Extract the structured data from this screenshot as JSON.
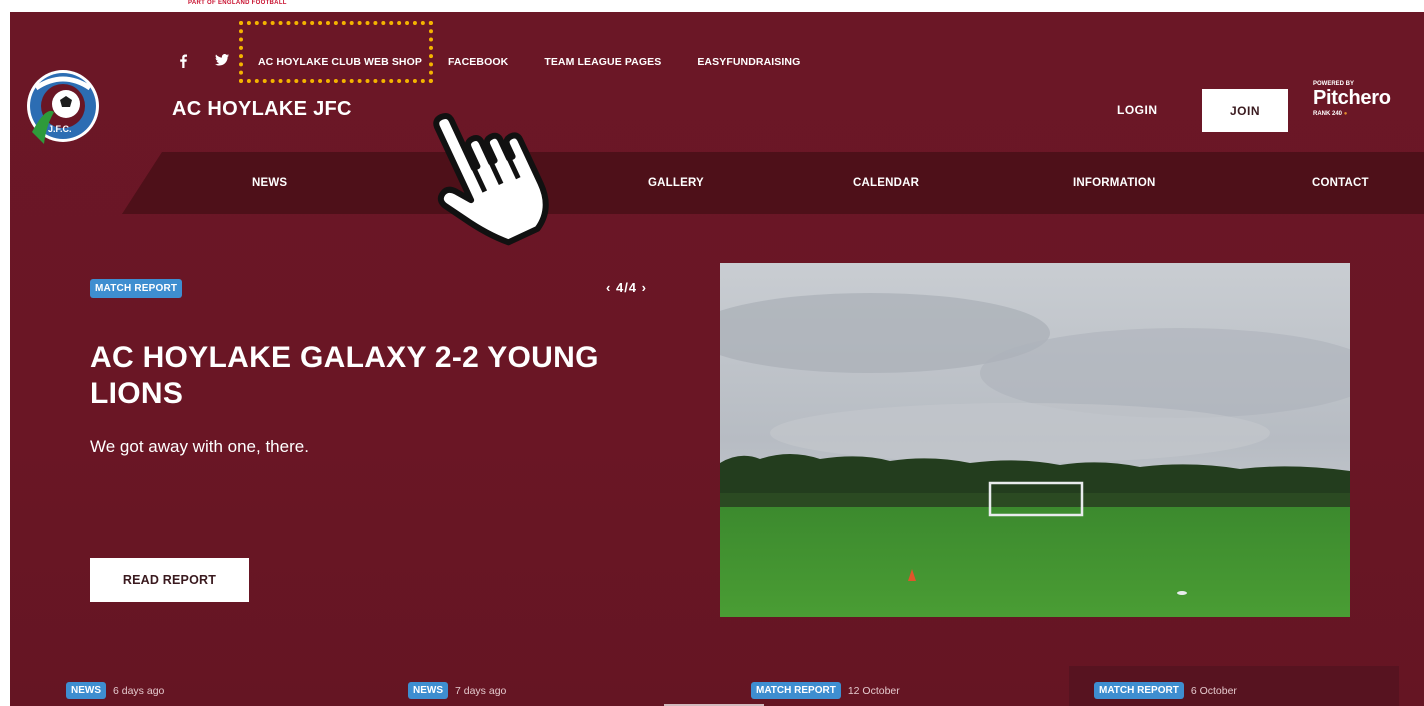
{
  "top_strip": {
    "tagline": "PART OF ENGLAND FOOTBALL"
  },
  "header": {
    "club_name": "AC HOYLAKE JFC",
    "social": {
      "facebook_icon": "facebook-icon",
      "twitter_icon": "twitter-icon"
    },
    "top_links": [
      {
        "label": "AC HOYLAKE CLUB WEB SHOP"
      },
      {
        "label": "FACEBOOK"
      },
      {
        "label": "TEAM LEAGUE PAGES"
      },
      {
        "label": "EASYFUNDRAISING"
      }
    ],
    "login_label": "LOGIN",
    "join_label": "JOIN",
    "powered_by": "POWERED BY",
    "brand": "Pitchero",
    "rank": "RANK 240"
  },
  "nav": {
    "items": [
      {
        "label": "NEWS"
      },
      {
        "label": "GALLERY"
      },
      {
        "label": "CALENDAR"
      },
      {
        "label": "INFORMATION"
      },
      {
        "label": "CONTACT"
      }
    ]
  },
  "hero": {
    "badge": "MATCH REPORT",
    "pager": "4/4",
    "title": "AC HOYLAKE GALAXY 2-2 YOUNG LIONS",
    "subtitle": "We got away with one, there.",
    "button": "READ REPORT"
  },
  "news_cards": [
    {
      "badge": "NEWS",
      "date": "6 days ago"
    },
    {
      "badge": "NEWS",
      "date": "7 days ago"
    },
    {
      "badge": "MATCH REPORT",
      "date": "12 October"
    },
    {
      "badge": "MATCH REPORT",
      "date": "6 October"
    }
  ],
  "colors": {
    "maroon": "#6a1625",
    "nav_dark": "#4e1019",
    "badge_blue": "#3e8ed0",
    "highlight_yellow": "#f4b400"
  }
}
